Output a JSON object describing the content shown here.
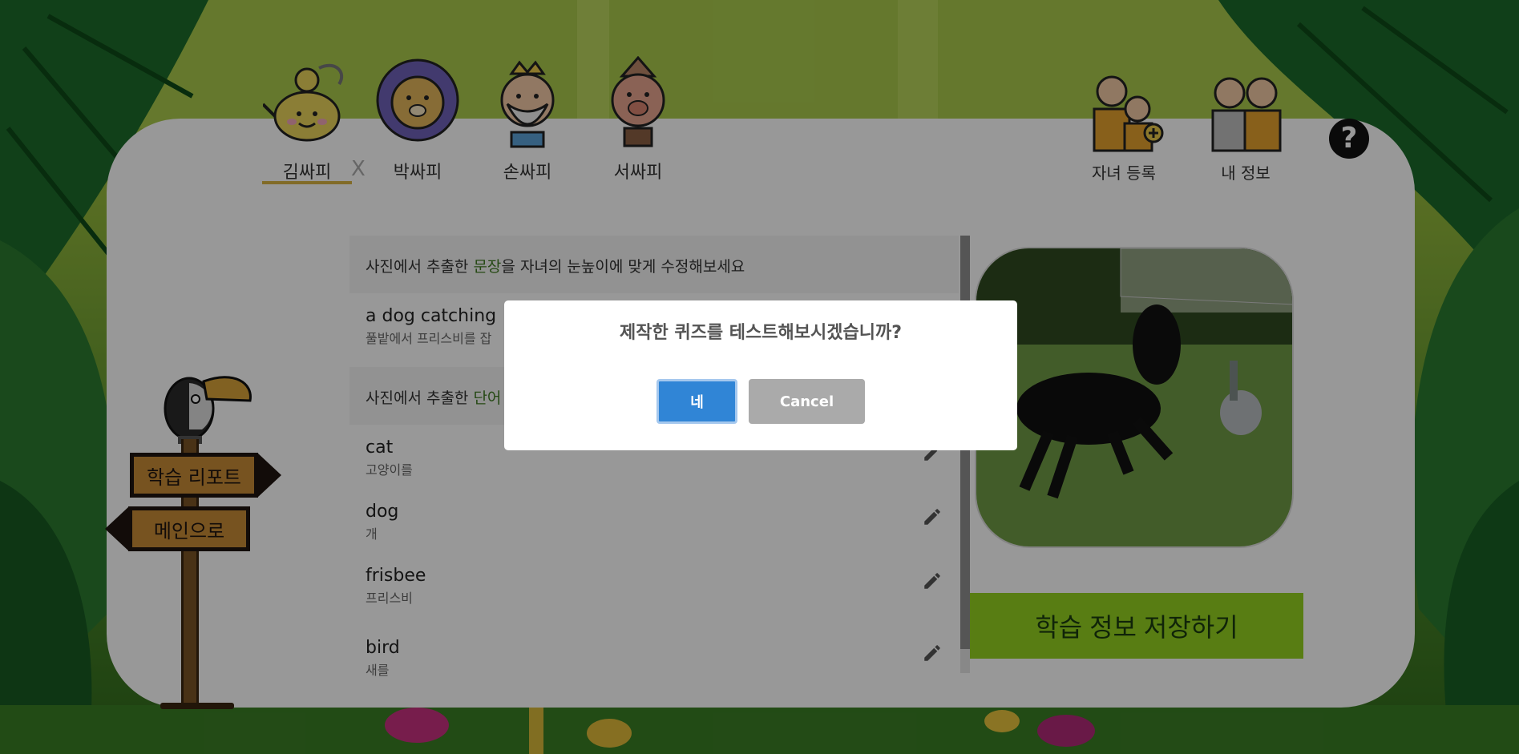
{
  "header": {
    "tabs": [
      {
        "label": "김싸피",
        "active": true
      },
      {
        "label": "박싸피",
        "active": false
      },
      {
        "label": "손싸피",
        "active": false
      },
      {
        "label": "서싸피",
        "active": false
      }
    ],
    "tab_close": "X",
    "register_child": "자녀 등록",
    "my_info": "내 정보",
    "help": "?"
  },
  "signpost": {
    "report": "학습 리포트",
    "main": "메인으로"
  },
  "sentence_section": {
    "prefix": "사진에서 추출한 ",
    "highlight": "문장",
    "suffix": "을 자녀의 눈높이에 맞게 수정해보세요",
    "sentence_en": "a dog catching",
    "sentence_ko": "풀밭에서 프리스비를 잡"
  },
  "word_section": {
    "prefix": "사진에서 추출한 ",
    "highlight": "단어",
    "words": [
      {
        "en": "cat",
        "ko": "고양이를"
      },
      {
        "en": "dog",
        "ko": "개"
      },
      {
        "en": "frisbee",
        "ko": "프리스비"
      },
      {
        "en": "bird",
        "ko": "새를"
      }
    ]
  },
  "save_button": "학습 정보 저장하기",
  "dialog": {
    "message": "제작한 퀴즈를 테스트해보시겠습니까?",
    "confirm": "네",
    "cancel": "Cancel"
  },
  "colors": {
    "accent_green": "#93d020",
    "confirm_blue": "#3085d6",
    "cancel_gray": "#aaaaaa",
    "tab_underline": "#d7b243"
  }
}
